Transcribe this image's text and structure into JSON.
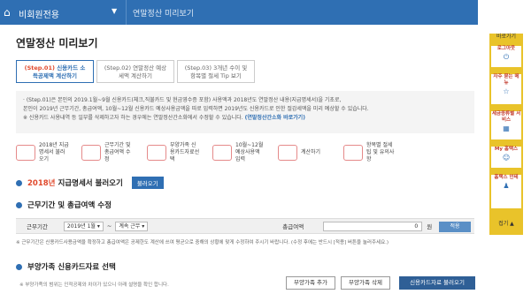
{
  "header": {
    "breadcrumb_main": "비회원전용",
    "breadcrumb_current": "연말정산 미리보기"
  },
  "page": {
    "title": "연말정산 미리보기"
  },
  "tabs": [
    {
      "step": "(Step.01)",
      "label": "신용카드 소득공제액 계산하기"
    },
    {
      "step": "(Step.02)",
      "label": "연말정산 예상세액 계산하기"
    },
    {
      "step": "(Step.03)",
      "label": "3개년 수이 및 항목별 절세 Tip 보기"
    }
  ],
  "notes": {
    "line1": "· (Step.01)은 본인의 2019.1월~9월 신용카드(체크,직불카드 및 현금영수증 포함) 사용액과 2018년도 연말정산 내용(지급명세서)을 기초로,",
    "line2": "  본인이 2019년 근무기간, 총급여액, 10월~12월 신용카드 예상사용금액을 따로 입력하면 2019년도 신용카드로 인한 절감세액을 미리 예상할 수 있습니다.",
    "line3": "※ 신용카드 사용내역 등 일부를 삭제하고자 하는 경우에는 연말정산간소화에서 수정할 수 있습니다.",
    "link": "(연말정산간소화 바로가기)"
  },
  "steps": [
    {
      "label": "2018년 지급명세서 불러오기"
    },
    {
      "label": "근무기간 및 총급여액 수정"
    },
    {
      "label": "부양가족 신용카드자료선택"
    },
    {
      "label": "10월~12월 예상사용액 입력"
    },
    {
      "label": "계산하기"
    },
    {
      "label": "항목별 절세 팁 및 유의사항"
    }
  ],
  "section1": {
    "year": "2018년",
    "title": "지급명세서 불러오기",
    "button": "불러오기"
  },
  "section2": {
    "title": "근무기간 및 총급여액 수정"
  },
  "period": {
    "label": "근무기간",
    "start": "2019년 1월",
    "end": "계속 근무",
    "income_label": "총급여액",
    "income_value": "0",
    "unit": "원",
    "apply": "적용"
  },
  "warn": "※ 근무기간은 신용카드사용금액을 확정하고 총급여액은 공제한도 계산에 쓰여 평균으로 중해의 상황에 맞게 수정하여 주시기 바랍니다. (수정 후에는 반드시 [적용] 버튼을 눌러주세요.)",
  "section3": {
    "title": "부양가족 신용카드자료 선택"
  },
  "footer": {
    "note": "※ 부양가족의 범위는 인적공제와 차이가 있으니 아래 설명을 확인 합니다.",
    "add_dependent": "부양가족 추가",
    "delete_dependent": "부양가족 삭제",
    "load_card": "신용카드자료 불러오기"
  },
  "sidebar": {
    "title": "바로가기",
    "items": [
      {
        "label": "로그아웃",
        "icon": "logout-icon"
      },
      {
        "label": "자주 묻는 메뉴",
        "icon": "star-icon"
      },
      {
        "label": "세금종류별 서비스",
        "icon": "grid-icon"
      },
      {
        "label": "My 홈택스",
        "icon": "user-icon"
      },
      {
        "label": "홈택스 인테",
        "icon": "person-icon"
      }
    ],
    "close": "접기 ▲"
  },
  "colors": {
    "primary": "#2f6fb3",
    "accent": "#e0492c",
    "sidebar": "#e9c32a"
  }
}
